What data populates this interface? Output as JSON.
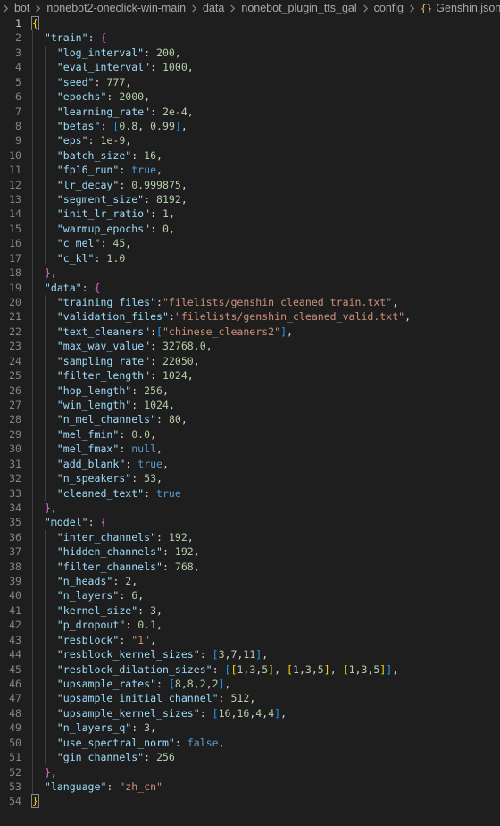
{
  "breadcrumb": {
    "items": [
      "bot",
      "nonebot2-oneclick-win-main",
      "data",
      "nonebot_plugin_tts_gal",
      "config"
    ],
    "file_icon": "{}",
    "file_name": "Genshin.json",
    "trailing": "..."
  },
  "editor": {
    "active_line": 1,
    "lines": [
      {
        "n": "1",
        "i": 0,
        "t": [
          [
            "br1",
            "{"
          ]
        ]
      },
      {
        "n": "2",
        "i": 1,
        "t": [
          [
            "k",
            "\"train\""
          ],
          [
            "p",
            ": "
          ],
          [
            "br2",
            "{"
          ]
        ]
      },
      {
        "n": "3",
        "i": 2,
        "t": [
          [
            "k",
            "\"log_interval\""
          ],
          [
            "p",
            ": "
          ],
          [
            "n",
            "200"
          ],
          [
            "p",
            ","
          ]
        ]
      },
      {
        "n": "4",
        "i": 2,
        "t": [
          [
            "k",
            "\"eval_interval\""
          ],
          [
            "p",
            ": "
          ],
          [
            "n",
            "1000"
          ],
          [
            "p",
            ","
          ]
        ]
      },
      {
        "n": "5",
        "i": 2,
        "t": [
          [
            "k",
            "\"seed\""
          ],
          [
            "p",
            ": "
          ],
          [
            "n",
            "777"
          ],
          [
            "p",
            ","
          ]
        ]
      },
      {
        "n": "6",
        "i": 2,
        "t": [
          [
            "k",
            "\"epochs\""
          ],
          [
            "p",
            ": "
          ],
          [
            "n",
            "2000"
          ],
          [
            "p",
            ","
          ]
        ]
      },
      {
        "n": "7",
        "i": 2,
        "t": [
          [
            "k",
            "\"learning_rate\""
          ],
          [
            "p",
            ": "
          ],
          [
            "n",
            "2e-4"
          ],
          [
            "p",
            ","
          ]
        ]
      },
      {
        "n": "8",
        "i": 2,
        "t": [
          [
            "k",
            "\"betas\""
          ],
          [
            "p",
            ": "
          ],
          [
            "br3",
            "["
          ],
          [
            "n",
            "0.8"
          ],
          [
            "p",
            ", "
          ],
          [
            "n",
            "0.99"
          ],
          [
            "br3",
            "]"
          ],
          [
            "p",
            ","
          ]
        ]
      },
      {
        "n": "9",
        "i": 2,
        "t": [
          [
            "k",
            "\"eps\""
          ],
          [
            "p",
            ": "
          ],
          [
            "n",
            "1e-9"
          ],
          [
            "p",
            ","
          ]
        ]
      },
      {
        "n": "10",
        "i": 2,
        "t": [
          [
            "k",
            "\"batch_size\""
          ],
          [
            "p",
            ": "
          ],
          [
            "n",
            "16"
          ],
          [
            "p",
            ","
          ]
        ]
      },
      {
        "n": "11",
        "i": 2,
        "t": [
          [
            "k",
            "\"fp16_run\""
          ],
          [
            "p",
            ": "
          ],
          [
            "b",
            "true"
          ],
          [
            "p",
            ","
          ]
        ]
      },
      {
        "n": "12",
        "i": 2,
        "t": [
          [
            "k",
            "\"lr_decay\""
          ],
          [
            "p",
            ": "
          ],
          [
            "n",
            "0.999875"
          ],
          [
            "p",
            ","
          ]
        ]
      },
      {
        "n": "13",
        "i": 2,
        "t": [
          [
            "k",
            "\"segment_size\""
          ],
          [
            "p",
            ": "
          ],
          [
            "n",
            "8192"
          ],
          [
            "p",
            ","
          ]
        ]
      },
      {
        "n": "14",
        "i": 2,
        "t": [
          [
            "k",
            "\"init_lr_ratio\""
          ],
          [
            "p",
            ": "
          ],
          [
            "n",
            "1"
          ],
          [
            "p",
            ","
          ]
        ]
      },
      {
        "n": "15",
        "i": 2,
        "t": [
          [
            "k",
            "\"warmup_epochs\""
          ],
          [
            "p",
            ": "
          ],
          [
            "n",
            "0"
          ],
          [
            "p",
            ","
          ]
        ]
      },
      {
        "n": "16",
        "i": 2,
        "t": [
          [
            "k",
            "\"c_mel\""
          ],
          [
            "p",
            ": "
          ],
          [
            "n",
            "45"
          ],
          [
            "p",
            ","
          ]
        ]
      },
      {
        "n": "17",
        "i": 2,
        "t": [
          [
            "k",
            "\"c_kl\""
          ],
          [
            "p",
            ": "
          ],
          [
            "n",
            "1.0"
          ]
        ]
      },
      {
        "n": "18",
        "i": 1,
        "t": [
          [
            "br2",
            "}"
          ],
          [
            "p",
            ","
          ]
        ]
      },
      {
        "n": "19",
        "i": 1,
        "t": [
          [
            "k",
            "\"data\""
          ],
          [
            "p",
            ": "
          ],
          [
            "br2",
            "{"
          ]
        ]
      },
      {
        "n": "20",
        "i": 2,
        "t": [
          [
            "k",
            "\"training_files\""
          ],
          [
            "p",
            ":"
          ],
          [
            "s",
            "\"filelists/genshin_cleaned_train.txt\""
          ],
          [
            "p",
            ","
          ]
        ]
      },
      {
        "n": "21",
        "i": 2,
        "t": [
          [
            "k",
            "\"validation_files\""
          ],
          [
            "p",
            ":"
          ],
          [
            "s",
            "\"filelists/genshin_cleaned_valid.txt\""
          ],
          [
            "p",
            ","
          ]
        ]
      },
      {
        "n": "22",
        "i": 2,
        "t": [
          [
            "k",
            "\"text_cleaners\""
          ],
          [
            "p",
            ":"
          ],
          [
            "br3",
            "["
          ],
          [
            "s",
            "\"chinese_cleaners2\""
          ],
          [
            "br3",
            "]"
          ],
          [
            "p",
            ","
          ]
        ]
      },
      {
        "n": "23",
        "i": 2,
        "t": [
          [
            "k",
            "\"max_wav_value\""
          ],
          [
            "p",
            ": "
          ],
          [
            "n",
            "32768.0"
          ],
          [
            "p",
            ","
          ]
        ]
      },
      {
        "n": "24",
        "i": 2,
        "t": [
          [
            "k",
            "\"sampling_rate\""
          ],
          [
            "p",
            ": "
          ],
          [
            "n",
            "22050"
          ],
          [
            "p",
            ","
          ]
        ]
      },
      {
        "n": "25",
        "i": 2,
        "t": [
          [
            "k",
            "\"filter_length\""
          ],
          [
            "p",
            ": "
          ],
          [
            "n",
            "1024"
          ],
          [
            "p",
            ","
          ]
        ]
      },
      {
        "n": "26",
        "i": 2,
        "t": [
          [
            "k",
            "\"hop_length\""
          ],
          [
            "p",
            ": "
          ],
          [
            "n",
            "256"
          ],
          [
            "p",
            ","
          ]
        ]
      },
      {
        "n": "27",
        "i": 2,
        "t": [
          [
            "k",
            "\"win_length\""
          ],
          [
            "p",
            ": "
          ],
          [
            "n",
            "1024"
          ],
          [
            "p",
            ","
          ]
        ]
      },
      {
        "n": "28",
        "i": 2,
        "t": [
          [
            "k",
            "\"n_mel_channels\""
          ],
          [
            "p",
            ": "
          ],
          [
            "n",
            "80"
          ],
          [
            "p",
            ","
          ]
        ]
      },
      {
        "n": "29",
        "i": 2,
        "t": [
          [
            "k",
            "\"mel_fmin\""
          ],
          [
            "p",
            ": "
          ],
          [
            "n",
            "0.0"
          ],
          [
            "p",
            ","
          ]
        ]
      },
      {
        "n": "30",
        "i": 2,
        "t": [
          [
            "k",
            "\"mel_fmax\""
          ],
          [
            "p",
            ": "
          ],
          [
            "b",
            "null"
          ],
          [
            "p",
            ","
          ]
        ]
      },
      {
        "n": "31",
        "i": 2,
        "t": [
          [
            "k",
            "\"add_blank\""
          ],
          [
            "p",
            ": "
          ],
          [
            "b",
            "true"
          ],
          [
            "p",
            ","
          ]
        ]
      },
      {
        "n": "32",
        "i": 2,
        "t": [
          [
            "k",
            "\"n_speakers\""
          ],
          [
            "p",
            ": "
          ],
          [
            "n",
            "53"
          ],
          [
            "p",
            ","
          ]
        ]
      },
      {
        "n": "33",
        "i": 2,
        "t": [
          [
            "k",
            "\"cleaned_text\""
          ],
          [
            "p",
            ": "
          ],
          [
            "b",
            "true"
          ]
        ]
      },
      {
        "n": "34",
        "i": 1,
        "t": [
          [
            "br2",
            "}"
          ],
          [
            "p",
            ","
          ]
        ]
      },
      {
        "n": "35",
        "i": 1,
        "t": [
          [
            "k",
            "\"model\""
          ],
          [
            "p",
            ": "
          ],
          [
            "br2",
            "{"
          ]
        ]
      },
      {
        "n": "36",
        "i": 2,
        "t": [
          [
            "k",
            "\"inter_channels\""
          ],
          [
            "p",
            ": "
          ],
          [
            "n",
            "192"
          ],
          [
            "p",
            ","
          ]
        ]
      },
      {
        "n": "37",
        "i": 2,
        "t": [
          [
            "k",
            "\"hidden_channels\""
          ],
          [
            "p",
            ": "
          ],
          [
            "n",
            "192"
          ],
          [
            "p",
            ","
          ]
        ]
      },
      {
        "n": "38",
        "i": 2,
        "t": [
          [
            "k",
            "\"filter_channels\""
          ],
          [
            "p",
            ": "
          ],
          [
            "n",
            "768"
          ],
          [
            "p",
            ","
          ]
        ]
      },
      {
        "n": "39",
        "i": 2,
        "t": [
          [
            "k",
            "\"n_heads\""
          ],
          [
            "p",
            ": "
          ],
          [
            "n",
            "2"
          ],
          [
            "p",
            ","
          ]
        ]
      },
      {
        "n": "40",
        "i": 2,
        "t": [
          [
            "k",
            "\"n_layers\""
          ],
          [
            "p",
            ": "
          ],
          [
            "n",
            "6"
          ],
          [
            "p",
            ","
          ]
        ]
      },
      {
        "n": "41",
        "i": 2,
        "t": [
          [
            "k",
            "\"kernel_size\""
          ],
          [
            "p",
            ": "
          ],
          [
            "n",
            "3"
          ],
          [
            "p",
            ","
          ]
        ]
      },
      {
        "n": "42",
        "i": 2,
        "t": [
          [
            "k",
            "\"p_dropout\""
          ],
          [
            "p",
            ": "
          ],
          [
            "n",
            "0.1"
          ],
          [
            "p",
            ","
          ]
        ]
      },
      {
        "n": "43",
        "i": 2,
        "t": [
          [
            "k",
            "\"resblock\""
          ],
          [
            "p",
            ": "
          ],
          [
            "s",
            "\"1\""
          ],
          [
            "p",
            ","
          ]
        ]
      },
      {
        "n": "44",
        "i": 2,
        "t": [
          [
            "k",
            "\"resblock_kernel_sizes\""
          ],
          [
            "p",
            ": "
          ],
          [
            "br3",
            "["
          ],
          [
            "n",
            "3"
          ],
          [
            "p",
            ","
          ],
          [
            "n",
            "7"
          ],
          [
            "p",
            ","
          ],
          [
            "n",
            "11"
          ],
          [
            "br3",
            "]"
          ],
          [
            "p",
            ","
          ]
        ]
      },
      {
        "n": "45",
        "i": 2,
        "t": [
          [
            "k",
            "\"resblock_dilation_sizes\""
          ],
          [
            "p",
            ": "
          ],
          [
            "br3",
            "["
          ],
          [
            "br1",
            "["
          ],
          [
            "n",
            "1"
          ],
          [
            "p",
            ","
          ],
          [
            "n",
            "3"
          ],
          [
            "p",
            ","
          ],
          [
            "n",
            "5"
          ],
          [
            "br1",
            "]"
          ],
          [
            "p",
            ", "
          ],
          [
            "br1",
            "["
          ],
          [
            "n",
            "1"
          ],
          [
            "p",
            ","
          ],
          [
            "n",
            "3"
          ],
          [
            "p",
            ","
          ],
          [
            "n",
            "5"
          ],
          [
            "br1",
            "]"
          ],
          [
            "p",
            ", "
          ],
          [
            "br1",
            "["
          ],
          [
            "n",
            "1"
          ],
          [
            "p",
            ","
          ],
          [
            "n",
            "3"
          ],
          [
            "p",
            ","
          ],
          [
            "n",
            "5"
          ],
          [
            "br1",
            "]"
          ],
          [
            "br3",
            "]"
          ],
          [
            "p",
            ","
          ]
        ]
      },
      {
        "n": "46",
        "i": 2,
        "t": [
          [
            "k",
            "\"upsample_rates\""
          ],
          [
            "p",
            ": "
          ],
          [
            "br3",
            "["
          ],
          [
            "n",
            "8"
          ],
          [
            "p",
            ","
          ],
          [
            "n",
            "8"
          ],
          [
            "p",
            ","
          ],
          [
            "n",
            "2"
          ],
          [
            "p",
            ","
          ],
          [
            "n",
            "2"
          ],
          [
            "br3",
            "]"
          ],
          [
            "p",
            ","
          ]
        ]
      },
      {
        "n": "47",
        "i": 2,
        "t": [
          [
            "k",
            "\"upsample_initial_channel\""
          ],
          [
            "p",
            ": "
          ],
          [
            "n",
            "512"
          ],
          [
            "p",
            ","
          ]
        ]
      },
      {
        "n": "48",
        "i": 2,
        "t": [
          [
            "k",
            "\"upsample_kernel_sizes\""
          ],
          [
            "p",
            ": "
          ],
          [
            "br3",
            "["
          ],
          [
            "n",
            "16"
          ],
          [
            "p",
            ","
          ],
          [
            "n",
            "16"
          ],
          [
            "p",
            ","
          ],
          [
            "n",
            "4"
          ],
          [
            "p",
            ","
          ],
          [
            "n",
            "4"
          ],
          [
            "br3",
            "]"
          ],
          [
            "p",
            ","
          ]
        ]
      },
      {
        "n": "49",
        "i": 2,
        "t": [
          [
            "k",
            "\"n_layers_q\""
          ],
          [
            "p",
            ": "
          ],
          [
            "n",
            "3"
          ],
          [
            "p",
            ","
          ]
        ]
      },
      {
        "n": "50",
        "i": 2,
        "t": [
          [
            "k",
            "\"use_spectral_norm\""
          ],
          [
            "p",
            ": "
          ],
          [
            "b",
            "false"
          ],
          [
            "p",
            ","
          ]
        ]
      },
      {
        "n": "51",
        "i": 2,
        "t": [
          [
            "k",
            "\"gin_channels\""
          ],
          [
            "p",
            ": "
          ],
          [
            "n",
            "256"
          ]
        ]
      },
      {
        "n": "52",
        "i": 1,
        "t": [
          [
            "br2",
            "}"
          ],
          [
            "p",
            ","
          ]
        ]
      },
      {
        "n": "53",
        "i": 1,
        "t": [
          [
            "k",
            "\"language\""
          ],
          [
            "p",
            ": "
          ],
          [
            "s",
            "\"zh_cn\""
          ]
        ]
      },
      {
        "n": "54",
        "i": 0,
        "t": [
          [
            "br1",
            "}"
          ]
        ]
      }
    ]
  }
}
